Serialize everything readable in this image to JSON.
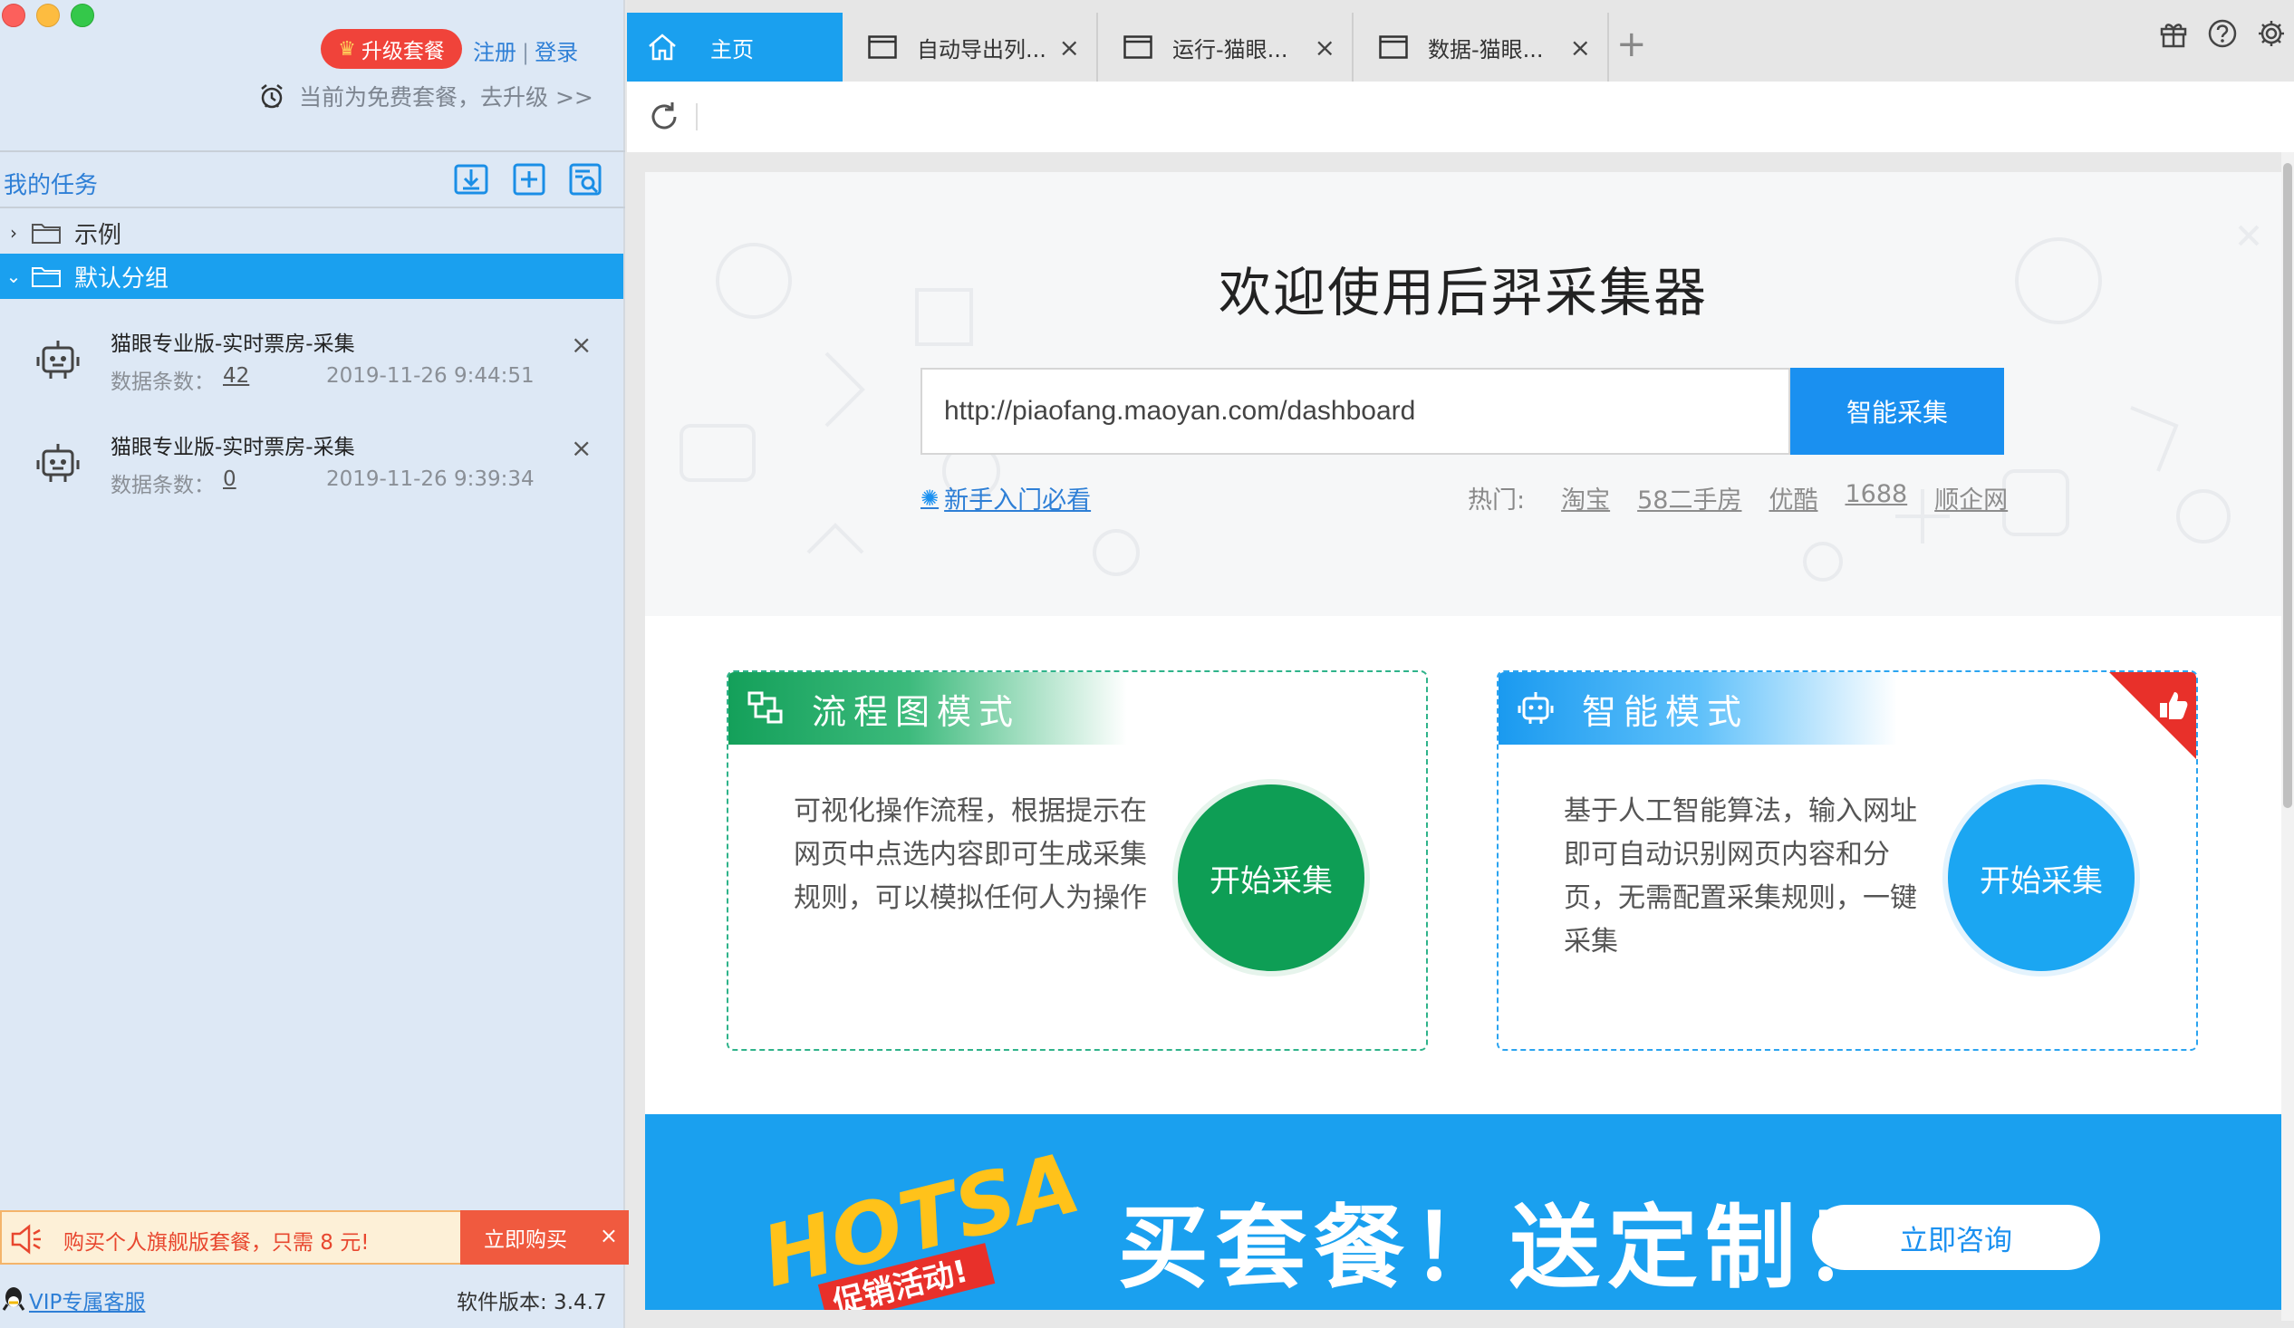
{
  "sidebar": {
    "upgrade_label": "升级套餐",
    "register_label": "注册",
    "login_label": "登录",
    "free_note": "当前为免费套餐，去升级 >>",
    "my_tasks_title": "我的任务",
    "tree": [
      {
        "label": "示例",
        "expanded": false
      },
      {
        "label": "默认分组",
        "expanded": true
      }
    ],
    "tasks": [
      {
        "name": "猫眼专业版-实时票房-采集",
        "count_label": "数据条数：",
        "count": "42",
        "time": "2019-11-26 9:44:51"
      },
      {
        "name": "猫眼专业版-实时票房-采集",
        "count_label": "数据条数：",
        "count": "0",
        "time": "2019-11-26 9:39:34"
      }
    ],
    "promo": {
      "text": "购买个人旗舰版套餐，只需 8 元!",
      "button": "立即购买"
    },
    "vip_support": "VIP专属客服",
    "version": "软件版本: 3.4.7"
  },
  "tabs": [
    {
      "label": "主页",
      "active": true
    },
    {
      "label": "自动导出列...",
      "active": false
    },
    {
      "label": "运行-猫眼...",
      "active": false
    },
    {
      "label": "数据-猫眼...",
      "active": false
    }
  ],
  "home": {
    "welcome_title": "欢迎使用后羿采集器",
    "url_value": "http://piaofang.maoyan.com/dashboard",
    "smart_collect_label": "智能采集",
    "newbie_link": "新手入门必看",
    "hot_label": "热门:",
    "hot_links": [
      "淘宝",
      "58二手房",
      "优酷",
      "1688",
      "顺企网"
    ]
  },
  "modes": [
    {
      "title": "流程图模式",
      "desc": "可视化操作流程，根据提示在网页中点选内容即可生成采集规则，可以模拟任何人为操作",
      "button": "开始采集"
    },
    {
      "title": "智能模式",
      "desc": "基于人工智能算法，输入网址即可自动识别网页内容和分页，无需配置采集规则，一键采集",
      "button": "开始采集"
    }
  ],
  "banner": {
    "art_text_1": "HOTSALE",
    "art_text_2": "促销活动!",
    "headline": "买套餐！送定制！",
    "consult_label": "立即咨询"
  },
  "colors": {
    "accent_blue": "#1aa0ef",
    "flow_green": "#0e9e55",
    "upgrade_red": "#f0433a",
    "promo_orange": "#f05a3f"
  },
  "icons": {
    "export": "download-icon",
    "new_task": "add-file-icon",
    "search": "search-file-icon",
    "gift": "gift-icon",
    "help": "help-icon",
    "settings": "gear-icon"
  }
}
